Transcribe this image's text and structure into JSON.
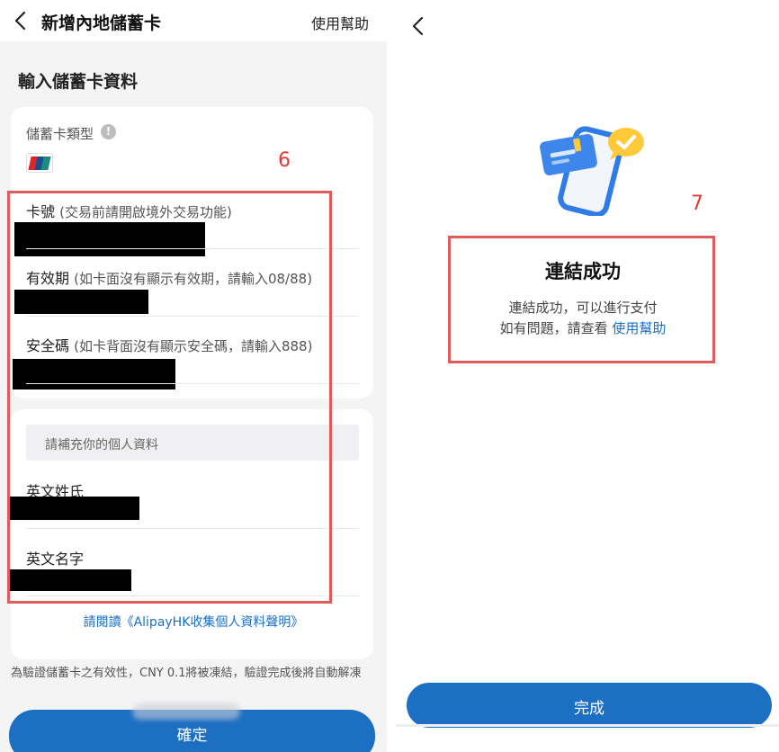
{
  "left_screen": {
    "nav": {
      "title": "新增內地儲蓄卡",
      "help": "使用幫助"
    },
    "section_title": "輸入儲蓄卡資料",
    "card_type": {
      "label": "儲蓄卡類型",
      "info": "!",
      "brand_icon": "unionpay-logo"
    },
    "annotation_number": "6",
    "fields": {
      "card_number": {
        "label": "卡號",
        "hint": "(交易前請開啟境外交易功能)"
      },
      "expiry": {
        "label": "有效期",
        "hint": "(如卡面沒有顯示有效期，請輸入08/88)"
      },
      "security_code": {
        "label": "安全碼",
        "hint": "(如卡背面沒有顯示安全碼，請輸入888)"
      }
    },
    "personal": {
      "banner": "請補充你的個人資料",
      "last_name": {
        "label": "英文姓氏"
      },
      "first_name": {
        "label": "英文名字"
      }
    },
    "privacy_link": "請閱讀《AlipayHK收集個人資料聲明》",
    "note": "為驗證儲蓄卡之有效性，CNY 0.1將被凍結，驗證完成後將自動解凍",
    "confirm_button": "確定"
  },
  "right_screen": {
    "annotation_number": "7",
    "title": "連結成功",
    "description": "連結成功，可以進行支付",
    "help_prefix": "如有問題，請查看 ",
    "help_link": "使用幫助",
    "done_button": "完成"
  },
  "colors": {
    "accent": "#1c6fc3",
    "link": "#1a6fc4",
    "annotation_red": "#e05c5c",
    "illustration_blue": "#2f7be8",
    "illustration_yellow": "#ffc93a"
  }
}
